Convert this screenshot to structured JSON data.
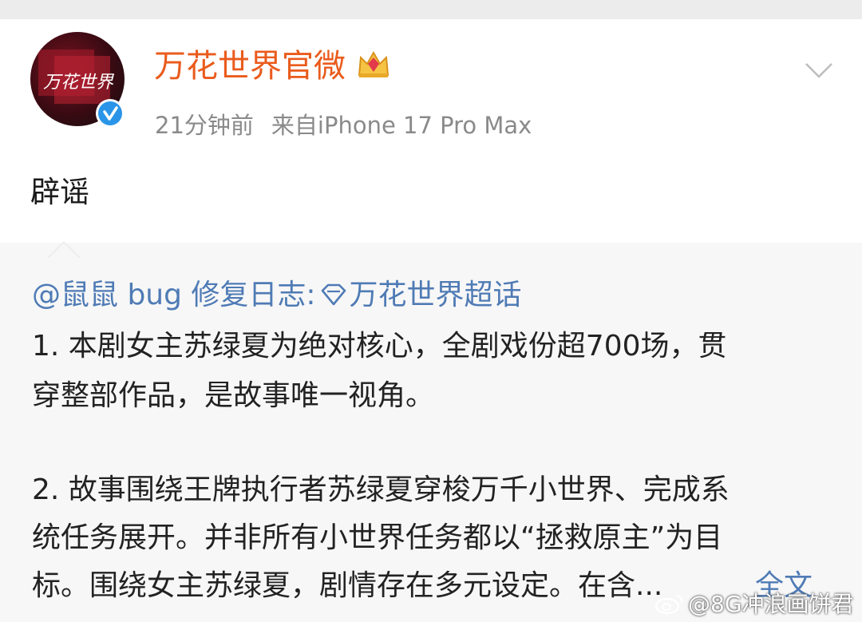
{
  "post": {
    "account_name": "万花世界官微",
    "time_ago": "21分钟前",
    "source": "来自iPhone 17 Pro Max",
    "text": "辟谣",
    "avatar_text": "万花世界"
  },
  "quoted": {
    "author_prefix": "@鼠鼠 bug 修复日志:",
    "topic": "万花世界超话",
    "lines": [
      "1. 本剧女主苏绿夏为绝对核心，全剧戏份超700场，贯",
      "穿整部作品，是故事唯一视角。",
      "2. 故事围绕王牌执行者苏绿夏穿梭万千小世界、完成系",
      "统任务展开。并非所有小世界任务都以“拯救原主”为目",
      "标。围绕女主苏绿夏，剧情存在多元设定。在含..."
    ],
    "full_text_label": "全文"
  },
  "watermark": "@8G冲浪画饼君",
  "colors": {
    "name_orange": "#ea5b1c",
    "link_blue": "#4f7bb5",
    "verified_blue": "#2a95e8",
    "meta_gray": "#8a8a8a"
  },
  "icons": {
    "crown": "crown-icon",
    "verified": "verified-icon",
    "dropdown": "chevron-down-icon",
    "topic": "diamond-icon"
  }
}
